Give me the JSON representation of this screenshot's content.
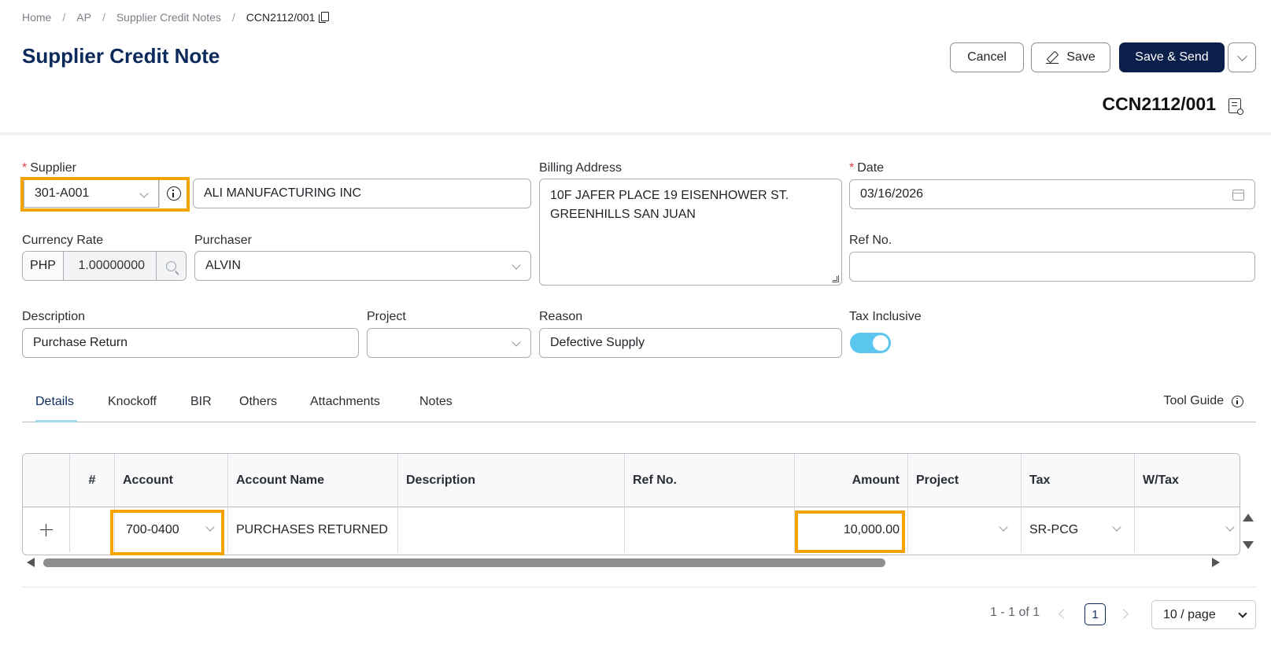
{
  "breadcrumb": {
    "items": [
      "Home",
      "AP",
      "Supplier Credit Notes"
    ],
    "current": "CCN2112/001"
  },
  "header": {
    "title": "Supplier Credit Note",
    "doc_number": "CCN2112/001",
    "buttons": {
      "cancel": "Cancel",
      "save": "Save",
      "save_send": "Save & Send"
    }
  },
  "form": {
    "supplier": {
      "label": "Supplier",
      "code": "301-A001",
      "name": "ALI MANUFACTURING INC"
    },
    "billing_address": {
      "label": "Billing Address",
      "line1": "10F JAFER PLACE 19 EISENHOWER ST.",
      "line2": "GREENHILLS SAN JUAN"
    },
    "date": {
      "label": "Date",
      "value": "03/16/2026"
    },
    "currency_rate": {
      "label": "Currency Rate",
      "currency": "PHP",
      "rate": "1.00000000"
    },
    "purchaser": {
      "label": "Purchaser",
      "value": "ALVIN"
    },
    "ref_no": {
      "label": "Ref No.",
      "value": ""
    },
    "description": {
      "label": "Description",
      "value": "Purchase Return"
    },
    "project": {
      "label": "Project",
      "value": ""
    },
    "reason": {
      "label": "Reason",
      "value": "Defective Supply"
    },
    "tax_inclusive": {
      "label": "Tax Inclusive",
      "on": true
    }
  },
  "tabs": {
    "items": [
      "Details",
      "Knockoff",
      "BIR",
      "Others",
      "Attachments",
      "Notes"
    ],
    "active": "Details",
    "tool_guide": "Tool Guide"
  },
  "table": {
    "headers": {
      "num": "#",
      "account": "Account",
      "account_name": "Account Name",
      "description": "Description",
      "ref_no": "Ref No.",
      "amount": "Amount",
      "project": "Project",
      "tax": "Tax",
      "wtax": "W/Tax"
    },
    "rows": [
      {
        "num": "",
        "account": "700-0400",
        "account_name": "PURCHASES RETURNED",
        "description": "",
        "ref_no": "",
        "amount": "10,000.00",
        "project": "",
        "tax": "SR-PCG",
        "wtax": ""
      }
    ]
  },
  "pagination": {
    "range": "1 - 1 of 1",
    "current_page": "1",
    "page_size": "10 / page"
  },
  "colors": {
    "primary": "#0a1f4a",
    "title": "#0b2a5b",
    "highlight": "#f5a300",
    "toggle": "#5bc7ee",
    "required": "#e5393a"
  }
}
